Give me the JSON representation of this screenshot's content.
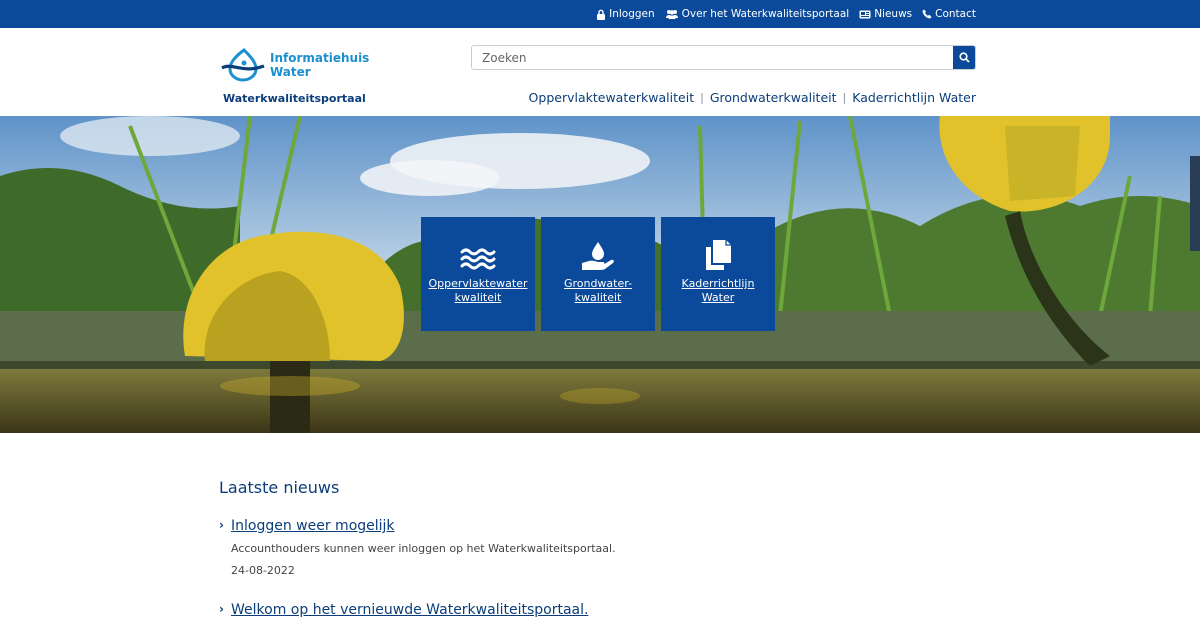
{
  "topnav": {
    "login": "Inloggen",
    "about": "Over het Waterkwaliteitsportaal",
    "news": "Nieuws",
    "contact": "Contact"
  },
  "logo": {
    "line1": "Informatiehuis",
    "line2": "Water",
    "subtitle": "Waterkwaliteitsportaal"
  },
  "search": {
    "placeholder": "Zoeken",
    "icon": "search-icon"
  },
  "mainnav": {
    "items": [
      "Oppervlaktewaterkwaliteit",
      "Grondwaterkwaliteit",
      "Kaderrichtlijn Water"
    ]
  },
  "tiles": [
    {
      "line1": "Oppervlaktewater",
      "line2": "kwaliteit",
      "icon": "waves-icon"
    },
    {
      "line1": "Grondwater-",
      "line2": "kwaliteit",
      "icon": "water-drop-hand-icon"
    },
    {
      "line1": "Kaderrichtlijn",
      "line2": "Water",
      "icon": "documents-icon"
    }
  ],
  "news": {
    "heading": "Laatste nieuws",
    "items": [
      {
        "title": "Inloggen weer mogelijk",
        "description": "Accounthouders kunnen weer inloggen op het Waterkwaliteitsportaal.",
        "date": "24-08-2022"
      },
      {
        "title": "Welkom op het vernieuwde Waterkwaliteitsportaal."
      }
    ]
  },
  "colors": {
    "brand_blue": "#0b4a9a",
    "text_blue": "#0b3d7a",
    "logo_light_blue": "#1c8fd0"
  }
}
